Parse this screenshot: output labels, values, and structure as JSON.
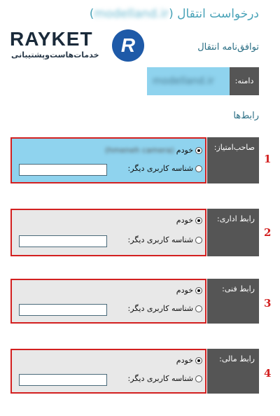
{
  "header": {
    "title_prefix": "درخواست انتقال (",
    "title_domain": "modelland.ir",
    "title_suffix": ")",
    "subtitle": "توافق‌نامه انتقال"
  },
  "logo": {
    "brand": "RAYKET",
    "tagline": "خدمات‌هاست‌وپشتیبانی",
    "icon_letter": "R",
    "colors": {
      "icon_bg": "#1e5aa8",
      "text": "#1a2a3a"
    }
  },
  "domain": {
    "label": "دامنه:",
    "value": "modelland.ir"
  },
  "contacts_title": "رابط‌ها",
  "contacts": [
    {
      "label": "صاحب‌امتیاز:",
      "self_label": "خودم",
      "self_hint": "(hmeneh camera)",
      "other_label": "شناسه کاربری دیگر:",
      "number": "1"
    },
    {
      "label": "رابط اداری:",
      "self_label": "خودم",
      "self_hint": "",
      "other_label": "شناسه کاربری دیگر:",
      "number": "2"
    },
    {
      "label": "رابط فنی:",
      "self_label": "خودم",
      "self_hint": "",
      "other_label": "شناسه کاربری دیگر:",
      "number": "3"
    },
    {
      "label": "رابط مالی:",
      "self_label": "خودم",
      "self_hint": "",
      "other_label": "شناسه کاربری دیگر:",
      "number": "4"
    }
  ],
  "colors": {
    "accent": "#4aa3b8",
    "highlight": "#8fd3ee",
    "label_bg": "#555555",
    "annotation": "#d32020"
  }
}
